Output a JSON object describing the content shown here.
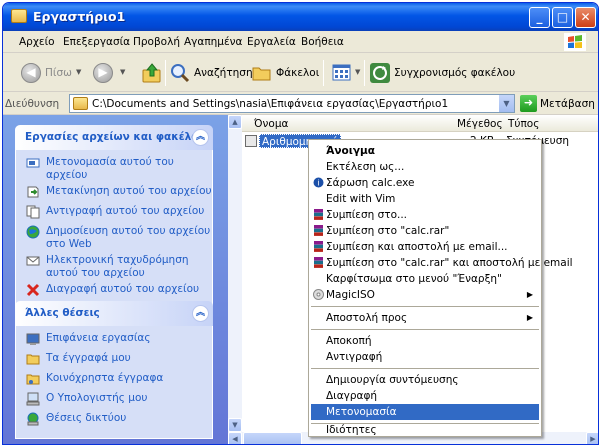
{
  "window": {
    "title": "Εργαστήριο1",
    "buttons": {
      "minimize": "_",
      "maximize": "□",
      "close": "✕"
    }
  },
  "menubar": [
    "Αρχείο",
    "Επεξεργασία",
    "Προβολή",
    "Αγαπημένα",
    "Εργαλεία",
    "Βοήθεια"
  ],
  "toolbar": {
    "back_label": "Πίσω",
    "search_label": "Αναζήτηση",
    "folders_label": "Φάκελοι",
    "sync_label": "Συγχρονισμός φακέλου"
  },
  "address": {
    "label": "Διεύθυνση",
    "path": "C:\\Documents and Settings\\nasia\\Επιφάνεια εργασίας\\Εργαστήριο1",
    "go_label": "Μετάβαση"
  },
  "tasks_panel": {
    "title": "Εργασίες αρχείων και φακέλων",
    "items": [
      "Μετονομασία αυτού του αρχείου",
      "Μετακίνηση αυτού του αρχείου",
      "Αντιγραφή αυτού του αρχείου",
      "Δημοσίευση αυτού του αρχείου στο Web",
      "Ηλεκτρονική ταχυδρόμηση αυτού του αρχείου",
      "Διαγραφή αυτού του αρχείου"
    ]
  },
  "places_panel": {
    "title": "Άλλες θέσεις",
    "items": [
      "Επιφάνεια εργασίας",
      "Τα έγγραφά μου",
      "Κοινόχρηστα έγγραφα",
      "Ο Υπολογιστής μου",
      "Θέσεις δικτύου"
    ]
  },
  "file_list": {
    "columns": [
      "Όνομα",
      "Μέγεθος",
      "Τύπος"
    ],
    "rows": [
      {
        "name": "Αριθμομηχανή",
        "size": "2 KB",
        "type": "Συντόμευση"
      }
    ]
  },
  "context_menu": {
    "items": [
      "Άνοιγμα",
      "Εκτέλεση ως...",
      "Σάρωση calc.exe",
      "Edit with Vim",
      "Συμπίεση στο...",
      "Συμπίεση στο \"calc.rar\"",
      "Συμπίεση και αποστολή με email...",
      "Συμπίεση στο \"calc.rar\" και αποστολή με email",
      "Καρφίτσωμα στο μενού \"Έναρξη\"",
      "MagicISO",
      "Αποστολή προς",
      "Αποκοπή",
      "Αντιγραφή",
      "Δημιουργία συντόμευσης",
      "Διαγραφή",
      "Μετονομασία",
      "Ιδιότητες"
    ],
    "selected": "Μετονομασία"
  },
  "colors": {
    "titlebar": "#0256e6",
    "taskpane": "#6f8de0",
    "selection": "#316ac5",
    "link": "#215dc6"
  }
}
